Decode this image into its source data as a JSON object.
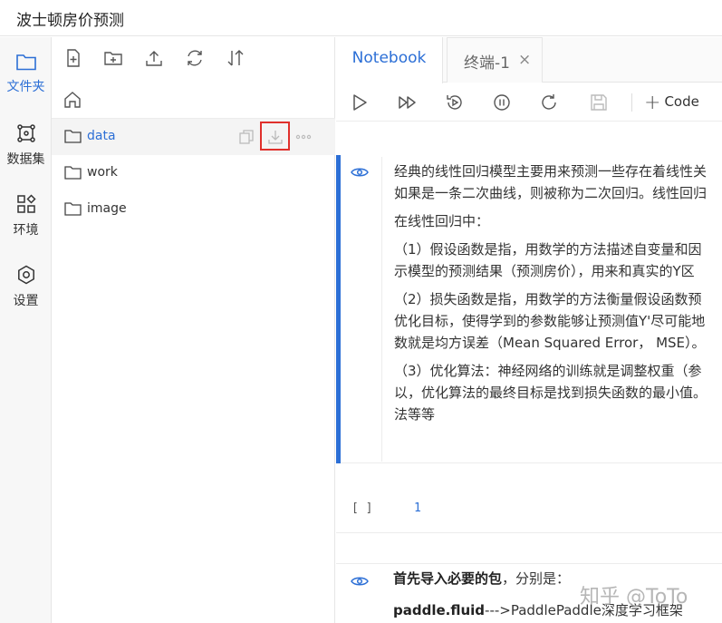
{
  "app": {
    "title": "波士顿房价预测"
  },
  "iconbar": {
    "items": [
      {
        "label": "文件夹",
        "icon": "folder-icon",
        "active": true
      },
      {
        "label": "数据集",
        "icon": "dataset-icon",
        "active": false
      },
      {
        "label": "环境",
        "icon": "environment-icon",
        "active": false
      },
      {
        "label": "设置",
        "icon": "settings-icon",
        "active": false
      }
    ]
  },
  "filepanel": {
    "toolbar": [
      "new-file-icon",
      "new-folder-icon",
      "upload-icon",
      "refresh-icon",
      "sort-icon"
    ],
    "files": [
      {
        "name": "data",
        "selected": true
      },
      {
        "name": "work",
        "selected": false
      },
      {
        "name": "image",
        "selected": false
      }
    ]
  },
  "tabs": [
    {
      "label": "Notebook",
      "active": true
    },
    {
      "label": "终端-1",
      "close": "×"
    }
  ],
  "nbtoolbar": {
    "code_label": "Code",
    "plus": "+"
  },
  "cells": {
    "md1": {
      "lines": [
        "经典的线性回归模型主要用来预测一些存在着线性关",
        "如果是一条二次曲线，则被称为二次回归。线性回归",
        "在线性回归中：",
        "（1）假设函数是指，用数学的方法描述自变量和因",
        "示模型的预测结果（预测房价），用来和真实的Y区",
        "（2）损失函数是指，用数学的方法衡量假设函数预",
        "优化目标，使得学到的参数能够让预测值Y'尽可能地",
        "数就是均方误差（Mean Squared Error， MSE）。",
        "（3）优化算法：神经网络的训练就是调整权重（参",
        "以，优化算法的最终目标是找到损失函数的最小值。",
        "法等等"
      ]
    },
    "code1": {
      "prompt": "[ ]",
      "line_number": "1"
    },
    "md2": {
      "line1_bold": "首先导入必要的包",
      "line1_rest": "，分别是：",
      "line2_bold": "paddle.fluid",
      "line2_rest": "--->PaddlePaddle深度学习框架"
    }
  },
  "watermark": "知乎 @ToTo",
  "colors": {
    "accent": "#2c6fd6",
    "highlight_box": "#e0302c"
  }
}
